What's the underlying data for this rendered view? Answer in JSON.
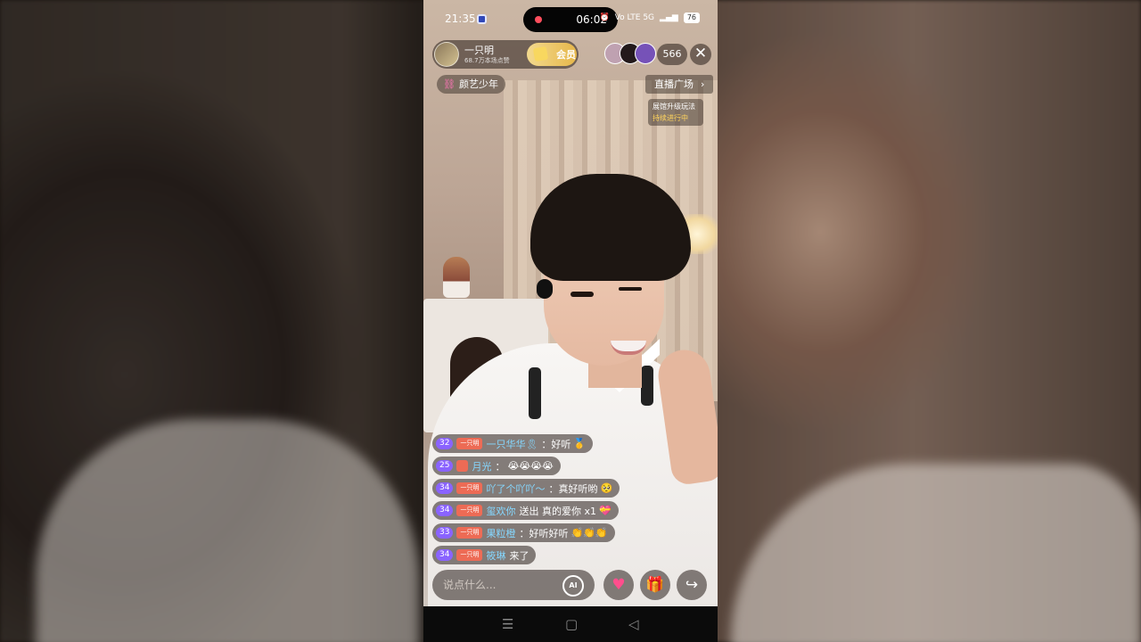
{
  "status": {
    "time": "21:35",
    "recording_time": "06:02",
    "network": "Vo LTE 5G",
    "battery": "76"
  },
  "host": {
    "name": "一只明",
    "likes": "68.7万本场点赞",
    "follow_label": "会员"
  },
  "viewers": {
    "count": "566"
  },
  "topic": {
    "label": "颜艺少年"
  },
  "plaza": {
    "label": "直播广场",
    "promo_line1": "展馆升级玩法",
    "promo_line2": "持续进行中"
  },
  "chat": [
    {
      "level": "32",
      "fan": "一只明",
      "user": "一只华华🎗",
      "message": "：好听",
      "emoji": "🥇"
    },
    {
      "level": "25",
      "fan": "",
      "user": "月光",
      "message": "：",
      "emoji": "😭😭😭😭"
    },
    {
      "level": "34",
      "fan": "一只明",
      "user": "吖了个吖吖～",
      "message": "：真好听哟",
      "emoji": "🥺"
    },
    {
      "level": "34",
      "fan": "一只明",
      "user": "玺欢你",
      "message": "送出 真的爱你 x1",
      "emoji": "💝"
    },
    {
      "level": "33",
      "fan": "一只明",
      "user": "果粒橙",
      "message": "：好听好听",
      "emoji": "👏👏👏"
    },
    {
      "level": "34",
      "fan": "一只明",
      "user": "筱琳",
      "message": "来了",
      "emoji": ""
    }
  ],
  "input": {
    "placeholder": "说点什么...",
    "ai_label": "AI"
  },
  "icons": {
    "heart": "heart-icon",
    "gift": "gift-icon",
    "share": "share-icon"
  },
  "nav": {
    "menu": "☰",
    "home": "▢",
    "back": "◁"
  }
}
